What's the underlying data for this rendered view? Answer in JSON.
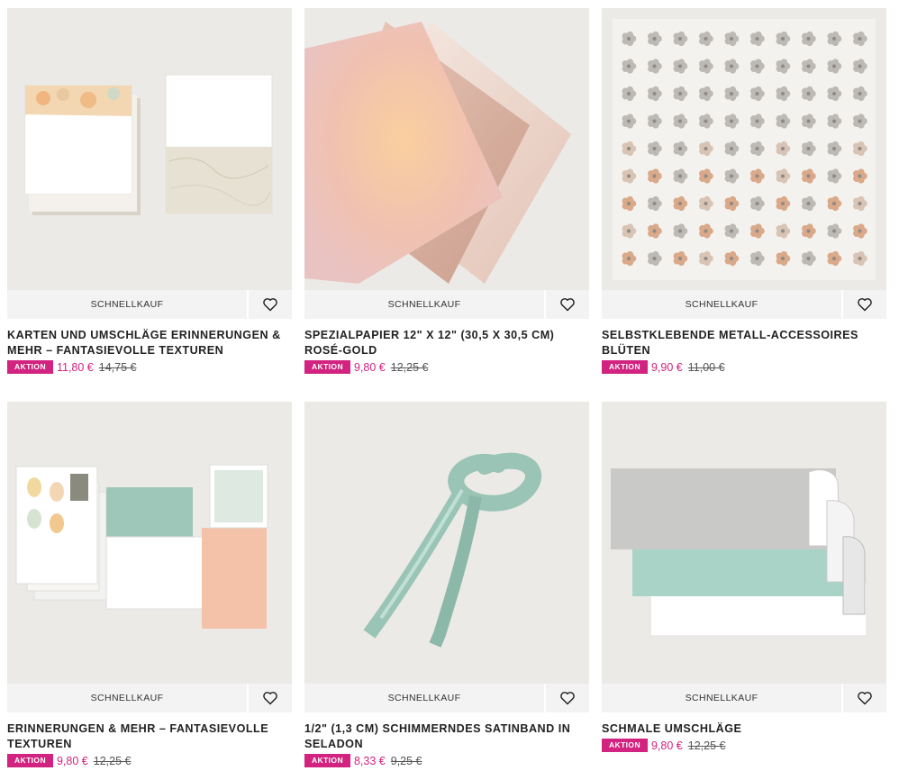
{
  "grid": {
    "quick_buy_label": "SCHNELLKAUF",
    "sale_badge": "AKTION",
    "products": [
      {
        "title": "KARTEN UND UMSCHLÄGE ERINNERUNGEN & MEHR – FANTASIEVOLLE TEXTUREN",
        "price": "11,80 €",
        "old_price": "14,75 €"
      },
      {
        "title": "SPEZIALPAPIER 12\" X 12\" (30,5 X 30,5 CM) ROSÉ-GOLD",
        "price": "9,80 €",
        "old_price": "12,25 €"
      },
      {
        "title": "SELBSTKLEBENDE METALL-ACCESSOIRES BLÜTEN",
        "price": "9,90 €",
        "old_price": "11,00 €"
      },
      {
        "title": "ERINNERUNGEN & MEHR – FANTASIEVOLLE TEXTUREN",
        "price": "9,80 €",
        "old_price": "12,25 €"
      },
      {
        "title": "1/2\" (1,3 CM) SCHIMMERNDES SATINBAND IN SELADON",
        "price": "8,33 €",
        "old_price": "9,25 €"
      },
      {
        "title": "SCHMALE UMSCHLÄGE",
        "price": "9,80 €",
        "old_price": "12,25 €"
      }
    ]
  },
  "colors": {
    "accent": "#d1237f",
    "bar": "#f3f3f3",
    "image_bg": "#eeece9"
  },
  "icons": {
    "wishlist": "heart-outline-icon"
  }
}
